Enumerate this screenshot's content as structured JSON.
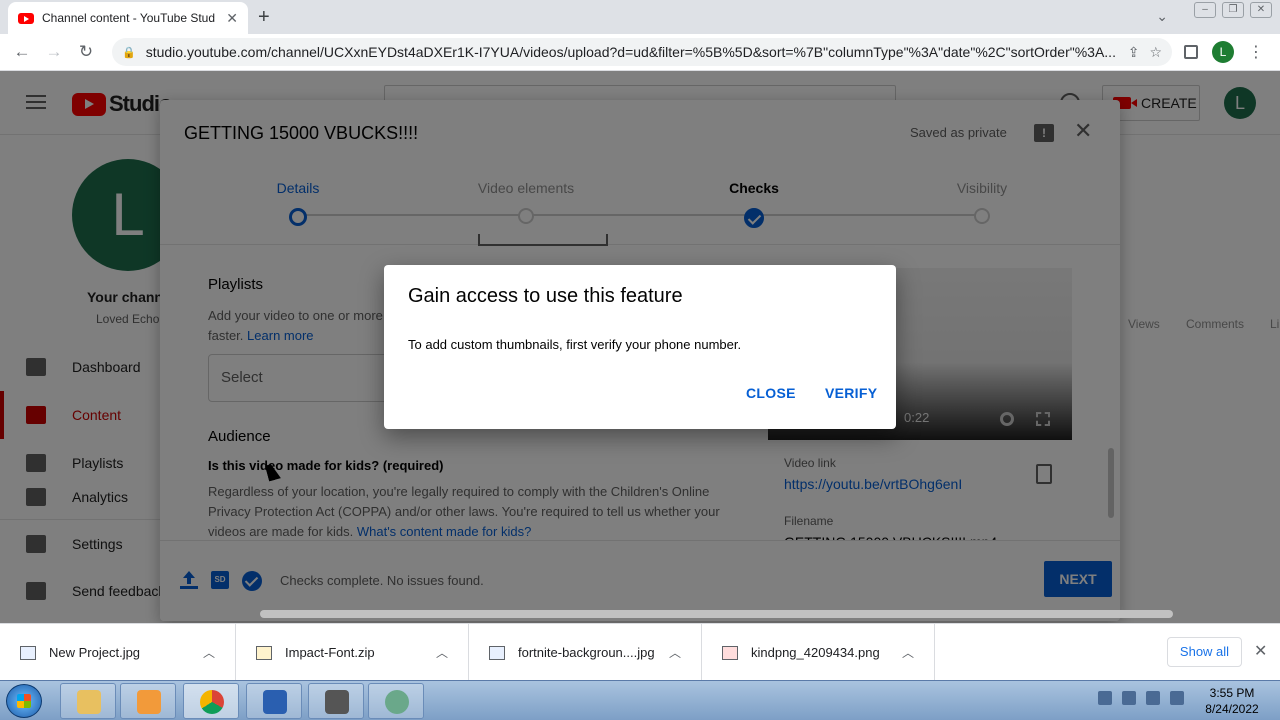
{
  "browser": {
    "tab_title": "Channel content - YouTube Stud",
    "url": "studio.youtube.com/channel/UCXxnEYDst4aDXEr1K-I7YUA/videos/upload?d=ud&filter=%5B%5D&sort=%7B\"columnType\"%3A\"date\"%2C\"sortOrder\"%3A...",
    "profile_initial": "L"
  },
  "studio_header": {
    "logo_text": "Studio",
    "create_label": "CREATE",
    "avatar_initial": "L"
  },
  "sidebar": {
    "avatar_initial": "L",
    "channel_title": "Your channe",
    "channel_sub": "Loved Echo",
    "items": [
      {
        "label": "Dashboard",
        "icon": "dashboard-icon"
      },
      {
        "label": "Content",
        "icon": "content-icon",
        "active": true
      },
      {
        "label": "Playlists",
        "icon": "playlists-icon"
      },
      {
        "label": "Analytics",
        "icon": "analytics-icon"
      },
      {
        "label": "Settings",
        "icon": "gear-icon"
      },
      {
        "label": "Send feedback",
        "icon": "feedback-icon"
      }
    ]
  },
  "table_columns": [
    "Views",
    "Comments",
    "Li"
  ],
  "upload": {
    "title": "GETTING 15000 VBUCKS!!!!",
    "saved_status": "Saved as private",
    "steps": [
      {
        "label": "Details",
        "state": "current"
      },
      {
        "label": "Video elements",
        "state": "pending"
      },
      {
        "label": "Checks",
        "state": "done"
      },
      {
        "label": "Visibility",
        "state": "pending"
      }
    ],
    "playlists": {
      "heading": "Playlists",
      "desc": "Add your video to one or more",
      "desc2": "faster.",
      "learn_more": "Learn more",
      "select_placeholder": "Select"
    },
    "audience": {
      "heading": "Audience",
      "question": "Is this video made for kids? (required)",
      "desc": "Regardless of your location, you're legally required to comply with the Children's Online Privacy Protection Act (COPPA) and/or other laws. You're required to tell us whether your videos are made for kids.",
      "link": "What's content made for kids?"
    },
    "preview": {
      "time": "0:22",
      "video_link_label": "Video link",
      "video_link": "https://youtu.be/vrtBOhg6enI",
      "filename_label": "Filename",
      "filename": "GETTING 15000 VBUCKS!!!!.mp4"
    },
    "footer": {
      "sd_badge": "SD",
      "status": "Checks complete. No issues found.",
      "next_label": "NEXT"
    }
  },
  "modal": {
    "title": "Gain access to use this feature",
    "body": "To add custom thumbnails, first verify your phone number.",
    "close_label": "CLOSE",
    "verify_label": "VERIFY"
  },
  "downloads": [
    {
      "name": "New Project.jpg",
      "type": "jpg"
    },
    {
      "name": "Impact-Font.zip",
      "type": "zip"
    },
    {
      "name": "fortnite-backgroun....jpg",
      "type": "jpg"
    },
    {
      "name": "kindpng_4209434.png",
      "type": "png"
    }
  ],
  "downloads_show_all": "Show all",
  "taskbar": {
    "time": "3:55 PM",
    "date": "8/24/2022"
  }
}
